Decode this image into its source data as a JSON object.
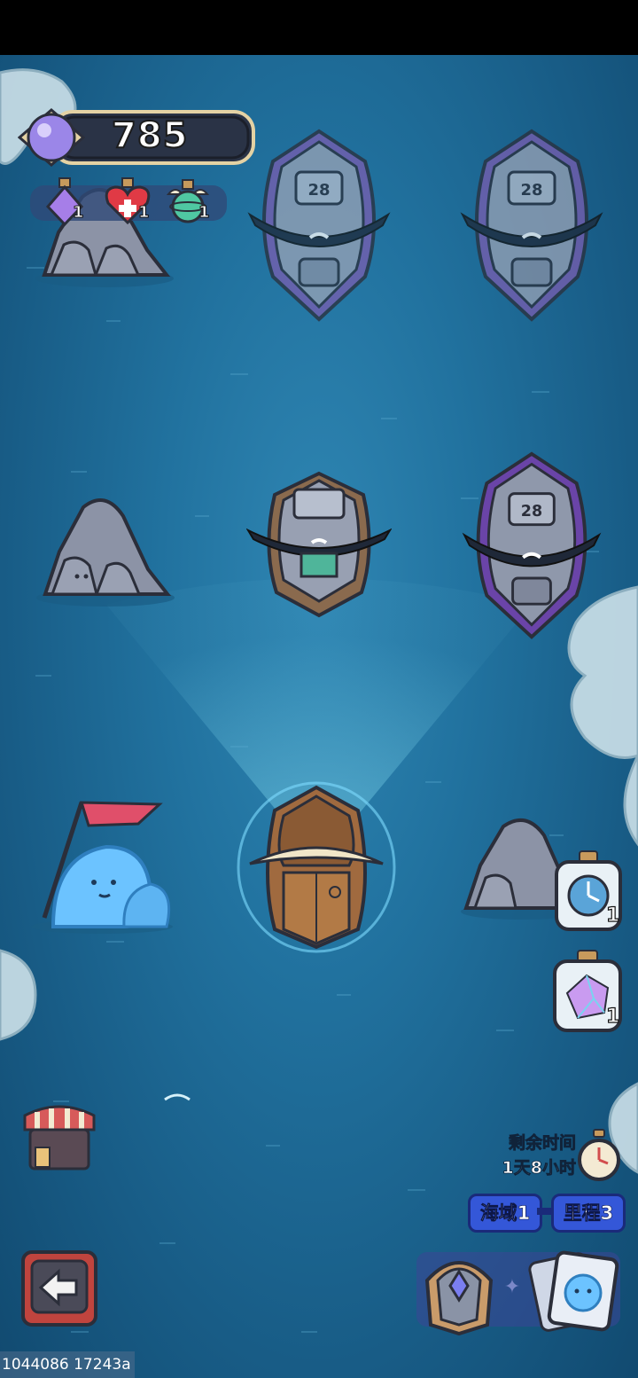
{
  "resources": {
    "currency_value": "785",
    "potions": [
      {
        "icon": "purple-potion-icon",
        "count": "1"
      },
      {
        "icon": "heart-potion-icon",
        "count": "1"
      },
      {
        "icon": "winged-flask-icon",
        "count": "1"
      }
    ]
  },
  "map": {
    "enemy_ship_level": "28",
    "enemy_ship_level_2": "28",
    "enemy_ship_level_3": "28"
  },
  "side_items": [
    {
      "icon": "stopwatch-jar-icon",
      "count": "1"
    },
    {
      "icon": "rainbow-crystal-jar-icon",
      "count": "1"
    }
  ],
  "event": {
    "time_label": "剩余时间",
    "time_value": "1天8小时",
    "sea_area": "海域1",
    "mileage": "里程3"
  },
  "debug_text": "1044086 17243a",
  "colors": {
    "sea": "#21729f",
    "pill_blue": "#3457d8",
    "back_button": "#c0443e"
  }
}
